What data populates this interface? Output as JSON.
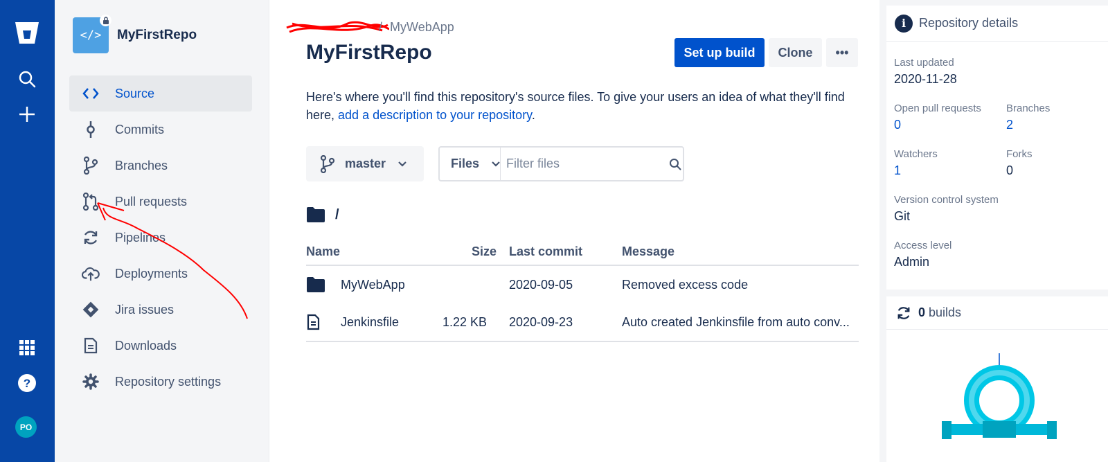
{
  "global_nav": {
    "items": [
      "bitbucket-logo",
      "search",
      "create"
    ],
    "bottom_items": [
      "app-switcher",
      "help"
    ],
    "avatar_initials": "PO",
    "accent": "#0747a6"
  },
  "repo": {
    "name": "MyFirstRepo",
    "avatar_glyph": "</>"
  },
  "sidebar": {
    "items": [
      {
        "label": "Source",
        "icon": "code-icon"
      },
      {
        "label": "Commits",
        "icon": "commit-icon"
      },
      {
        "label": "Branches",
        "icon": "branch-icon"
      },
      {
        "label": "Pull requests",
        "icon": "pull-request-icon"
      },
      {
        "label": "Pipelines",
        "icon": "pipelines-icon"
      },
      {
        "label": "Deployments",
        "icon": "cloud-upload-icon"
      },
      {
        "label": "Jira issues",
        "icon": "jira-icon"
      },
      {
        "label": "Downloads",
        "icon": "document-icon"
      },
      {
        "label": "Repository settings",
        "icon": "gear-icon"
      }
    ]
  },
  "main": {
    "breadcrumb_sep": "/",
    "breadcrumb_project": "MyWebApp",
    "title": "MyFirstRepo",
    "setup_build_label": "Set up build",
    "clone_label": "Clone",
    "more_label": "•••",
    "desc_text": "Here's where you'll find this repository's source files. To give your users an idea of what they'll find here, ",
    "desc_link": "add a description to your repository",
    "desc_end": ".",
    "branch": "master",
    "filter_type": "Files",
    "filter_placeholder": "Filter files",
    "path": "/",
    "columns": {
      "name": "Name",
      "size": "Size",
      "last_commit": "Last commit",
      "message": "Message"
    },
    "rows": [
      {
        "name": "MyWebApp",
        "type": "folder",
        "size": "",
        "last_commit": "2020-09-05",
        "message": "Removed excess code"
      },
      {
        "name": "Jenkinsfile",
        "type": "file",
        "size": "1.22 KB",
        "last_commit": "2020-09-23",
        "message": "Auto created Jenkinsfile from auto conv..."
      }
    ]
  },
  "details": {
    "title": "Repository details",
    "last_updated_label": "Last updated",
    "last_updated": "2020-11-28",
    "open_prs_label": "Open pull requests",
    "open_prs": "0",
    "branches_label": "Branches",
    "branches": "2",
    "watchers_label": "Watchers",
    "watchers": "1",
    "forks_label": "Forks",
    "forks": "0",
    "vcs_label": "Version control system",
    "vcs": "Git",
    "access_label": "Access level",
    "access": "Admin"
  },
  "builds": {
    "count": "0",
    "label": "builds"
  }
}
